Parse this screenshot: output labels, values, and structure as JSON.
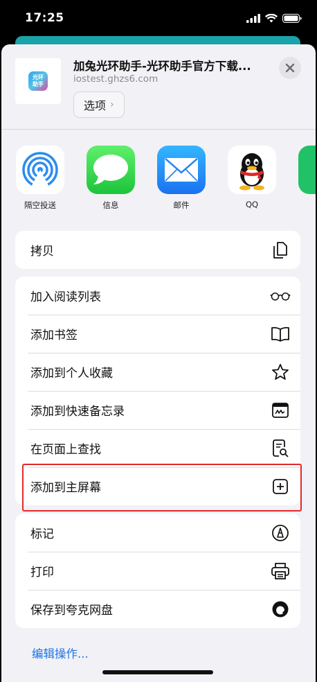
{
  "status_bar": {
    "time": "17:25"
  },
  "share_sheet": {
    "header": {
      "title": "加兔光环助手-光环助手官方下载...",
      "url": "iostest.ghzs6.com",
      "options_label": "选项",
      "app_icon_text": "光环\n助手"
    },
    "apps": [
      {
        "label": "隔空投送",
        "icon": "airdrop-icon"
      },
      {
        "label": "信息",
        "icon": "messages-icon"
      },
      {
        "label": "邮件",
        "icon": "mail-icon"
      },
      {
        "label": "QQ",
        "icon": "qq-icon"
      }
    ],
    "groups": [
      [
        {
          "label": "拷贝",
          "icon": "copy-icon"
        }
      ],
      [
        {
          "label": "加入阅读列表",
          "icon": "glasses-icon"
        },
        {
          "label": "添加书签",
          "icon": "book-icon"
        },
        {
          "label": "添加到个人收藏",
          "icon": "star-icon"
        },
        {
          "label": "添加到快速备忘录",
          "icon": "quick-note-icon"
        },
        {
          "label": "在页面上查找",
          "icon": "find-in-page-icon"
        },
        {
          "label": "添加到主屏幕",
          "icon": "add-square-icon"
        }
      ],
      [
        {
          "label": "标记",
          "icon": "markup-icon"
        },
        {
          "label": "打印",
          "icon": "printer-icon"
        },
        {
          "label": "保存到夸克网盘",
          "icon": "quark-icon"
        }
      ]
    ],
    "edit_actions_label": "编辑操作..."
  },
  "colors": {
    "link_blue": "#1a73e8",
    "highlight_red": "#e3282a",
    "sheet_bg": "#f2f2f6"
  }
}
